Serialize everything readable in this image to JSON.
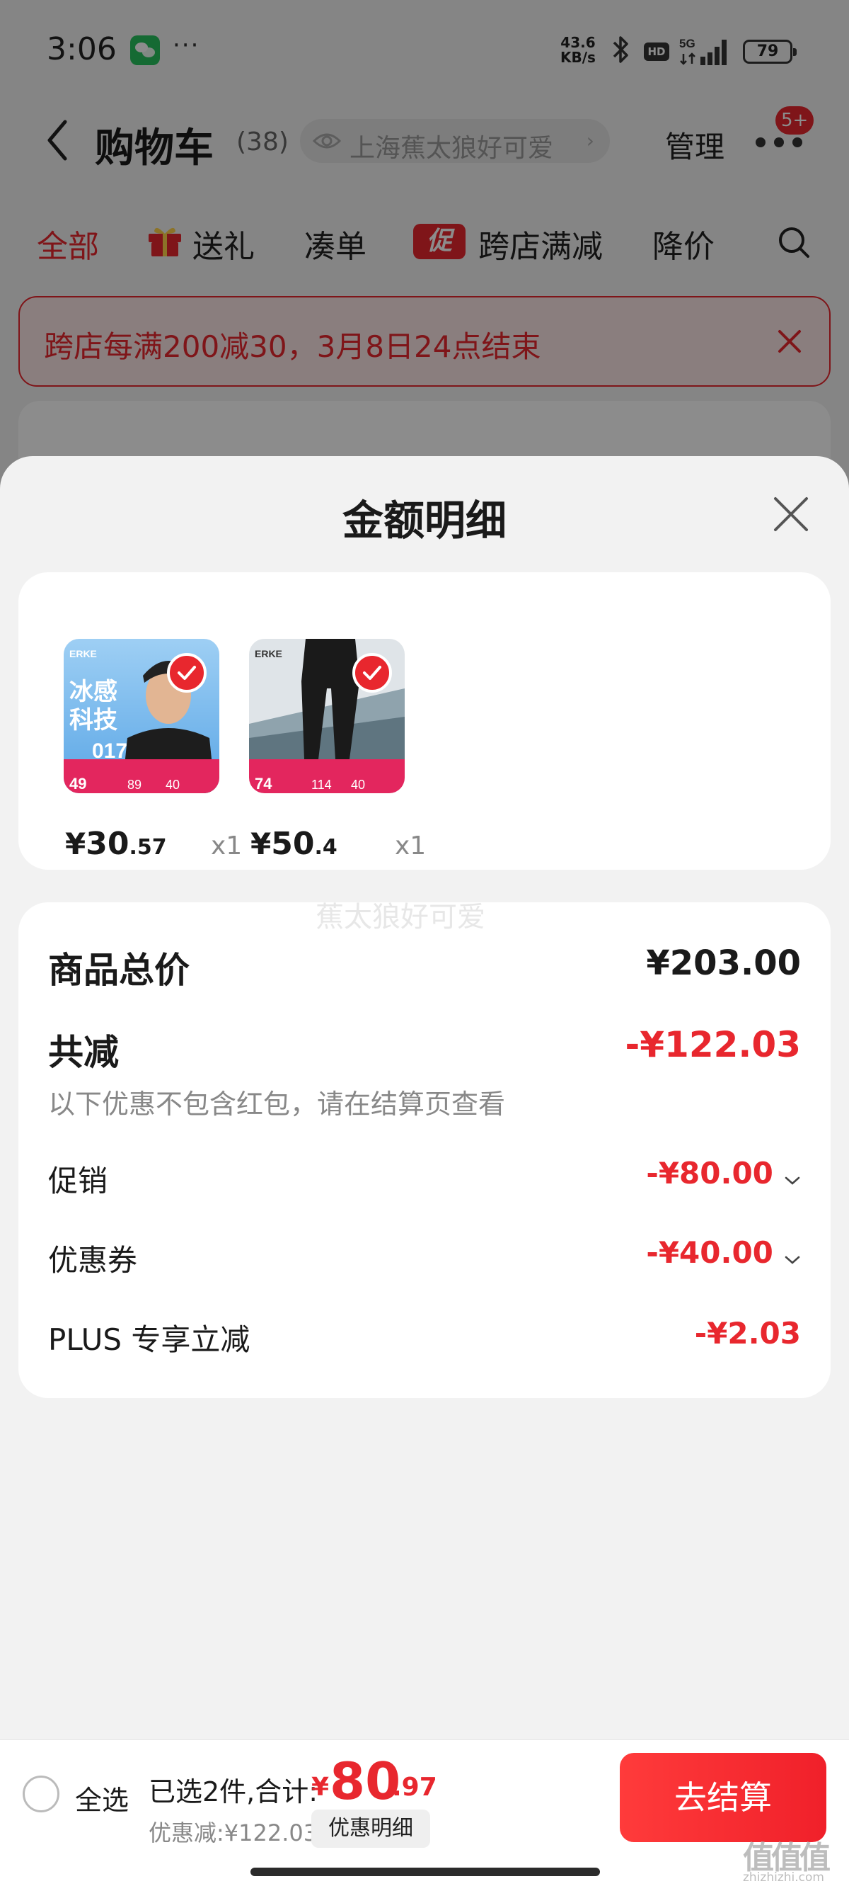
{
  "status_bar": {
    "time": "3:06",
    "more_dots": "···",
    "net_speed_value": "43.6",
    "net_speed_unit": "KB/s",
    "hd_label": "HD",
    "network_label": "5G",
    "battery": "79"
  },
  "nav": {
    "title": "购物车",
    "count": "(38)",
    "location": "上海蕉太狼好可爱",
    "manage_label": "管理",
    "more_badge": "5+"
  },
  "filter_tabs": [
    {
      "label": "全部",
      "active": true
    },
    {
      "label": "送礼"
    },
    {
      "label": "凑单"
    },
    {
      "label": "跨店满减",
      "icon_text": "促"
    },
    {
      "label": "降价"
    }
  ],
  "promo_banner": {
    "text": "跨店每满200减30，3月8日24点结束"
  },
  "sheet": {
    "title": "金额明细",
    "watermark": "蕉太狼好可爱",
    "items": [
      {
        "price_symbol": "¥",
        "price_int": "30",
        "price_dec": ".57",
        "qty": "x1",
        "image_text": {
          "brand": "ERKE",
          "headline1": "冰感",
          "headline2": "科技",
          "tag": "017",
          "price_a": "49",
          "price_b": "89",
          "price_c": "40"
        }
      },
      {
        "price_symbol": "¥",
        "price_int": "50",
        "price_dec": ".4",
        "qty": "x1",
        "image_text": {
          "brand": "ERKE",
          "price_a": "74",
          "price_b": "114",
          "price_c": "40"
        }
      }
    ],
    "summary": {
      "total_label": "商品总价",
      "total_value": "¥203.00",
      "reduce_label": "共减",
      "reduce_value": "-¥122.03",
      "reduce_note": "以下优惠不包含红包，请在结算页查看",
      "rows": [
        {
          "label": "促销",
          "value": "-¥80.00",
          "expandable": true
        },
        {
          "label": "优惠券",
          "value": "-¥40.00",
          "expandable": true
        },
        {
          "label": "PLUS 专享立减",
          "value": "-¥2.03",
          "expandable": false
        }
      ]
    }
  },
  "checkout": {
    "select_all_label": "全选",
    "selected_text": "已选2件,合计:",
    "total_symbol": "¥",
    "total_int": "80",
    "total_dec": ".97",
    "discount_text": "优惠减:¥122.03",
    "detail_button": "优惠明细",
    "checkout_button": "去结算"
  },
  "corner_logo": {
    "text": "值值值",
    "url": "zhizhizhi.com"
  },
  "colors": {
    "accent": "#e8272e",
    "sheet_bg": "#f2f2f2",
    "card_bg": "#ffffff"
  }
}
